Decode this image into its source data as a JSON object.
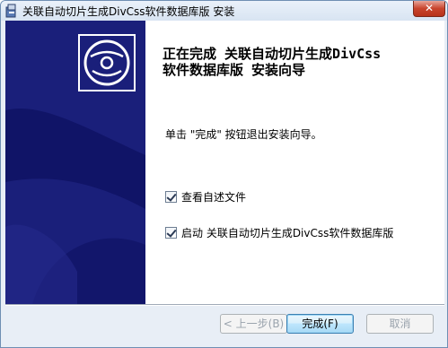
{
  "window": {
    "title": "关联自动切片生成DivCss软件数据库版 安装",
    "close_label": "✕"
  },
  "icons": {
    "title": "installer-icon",
    "banner": "cd-disc-icon",
    "close": "close-icon"
  },
  "page": {
    "heading_line1": "正在完成 关联自动切片生成DivCss",
    "heading_line2": "软件数据库版 安装向导",
    "description": "单击 \"完成\" 按钮退出安装向导。"
  },
  "options": [
    {
      "label": "查看自述文件",
      "checked": true
    },
    {
      "label": "启动 关联自动切片生成DivCss软件数据库版",
      "checked": true
    }
  ],
  "buttons": {
    "back": "< 上一步(B)",
    "finish": "完成(F)",
    "cancel": "取消"
  },
  "colors": {
    "banner_bg": "#1a1f7a",
    "banner_accent": "#0d1060"
  }
}
